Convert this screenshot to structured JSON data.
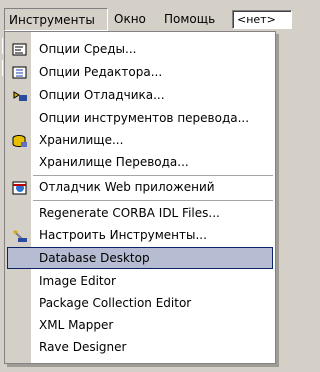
{
  "menubar": {
    "tools": "Инструменты",
    "window": "Окно",
    "help": "Помощь",
    "combo_value": "<нет>"
  },
  "menu": {
    "items": [
      {
        "label": "Опции Среды...",
        "icon": "environment-options-icon"
      },
      {
        "label": "Опции Редактора...",
        "icon": "editor-options-icon"
      },
      {
        "label": "Опции Отладчика...",
        "icon": "debugger-options-icon"
      },
      {
        "label": "Опции инструментов перевода...",
        "icon": ""
      },
      {
        "label": "Хранилище...",
        "icon": "repository-icon"
      },
      {
        "label": "Хранилище Перевода...",
        "icon": ""
      },
      {
        "label": "Отладчик Web приложений",
        "icon": "web-debugger-icon"
      },
      {
        "label": "Regenerate CORBA IDL Files...",
        "icon": ""
      },
      {
        "label": "Настроить Инструменты...",
        "icon": "configure-tools-icon"
      },
      {
        "label": "Database Desktop",
        "icon": "",
        "selected": true
      },
      {
        "label": "Image Editor",
        "icon": ""
      },
      {
        "label": "Package Collection Editor",
        "icon": ""
      },
      {
        "label": "XML Mapper",
        "icon": ""
      },
      {
        "label": "Rave Designer",
        "icon": ""
      }
    ]
  },
  "colors": {
    "menu_bg": "#ffffff",
    "gutter": "#d4d0c8",
    "highlight": "#b6bdd2",
    "highlight_border": "#0a246a"
  }
}
